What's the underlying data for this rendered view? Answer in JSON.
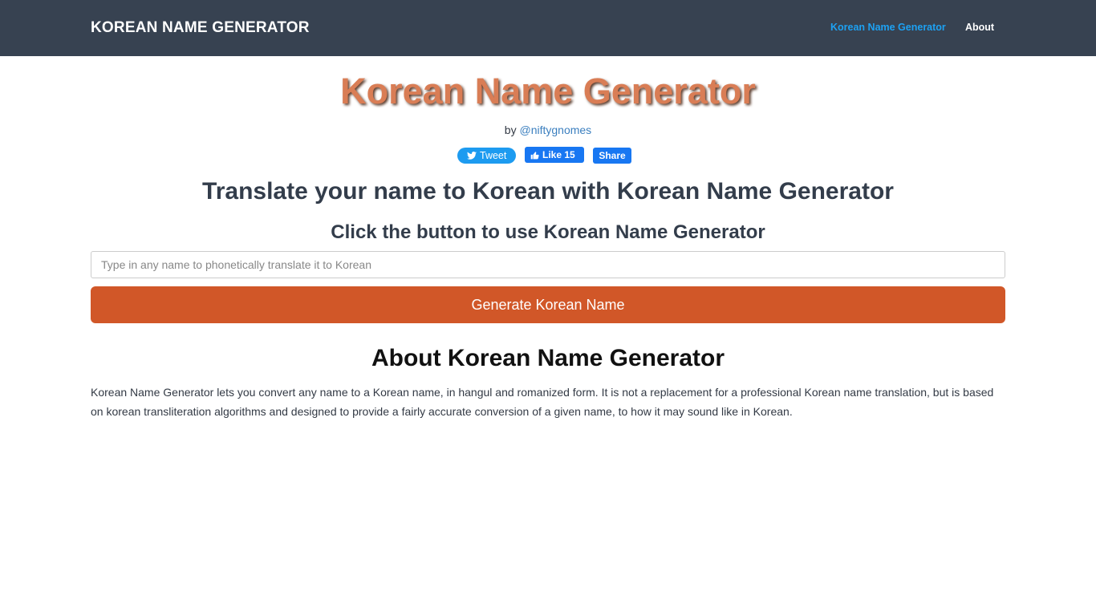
{
  "navbar": {
    "brand": "KOREAN NAME GENERATOR",
    "links": [
      {
        "label": "Korean Name Generator",
        "active": true
      },
      {
        "label": "About",
        "active": false
      }
    ]
  },
  "hero": {
    "title": "Korean Name Generator",
    "by_prefix": "by",
    "author_link": "@niftygnomes"
  },
  "social": {
    "tweet_label": "Tweet",
    "like_label": "Like 15",
    "share_label": "Share"
  },
  "main": {
    "heading": "Translate your name to Korean with Korean Name Generator",
    "subheading": "Click the button to use Korean Name Generator",
    "input_value": "",
    "input_placeholder": "Type in any name to phonetically translate it to Korean",
    "button_label": "Generate Korean Name"
  },
  "about": {
    "heading": "About Korean Name Generator",
    "text": "Korean Name Generator lets you convert any name to a Korean name, in hangul and romanized form. It is not a replacement for a professional Korean name translation, but is based on korean transliteration algorithms and designed to provide a fairly accurate conversion of a given name, to how it may sound like in Korean."
  },
  "colors": {
    "navbar_bg": "#374251",
    "accent_link": "#1da1f2",
    "title": "#d97d55",
    "button": "#d15728"
  }
}
